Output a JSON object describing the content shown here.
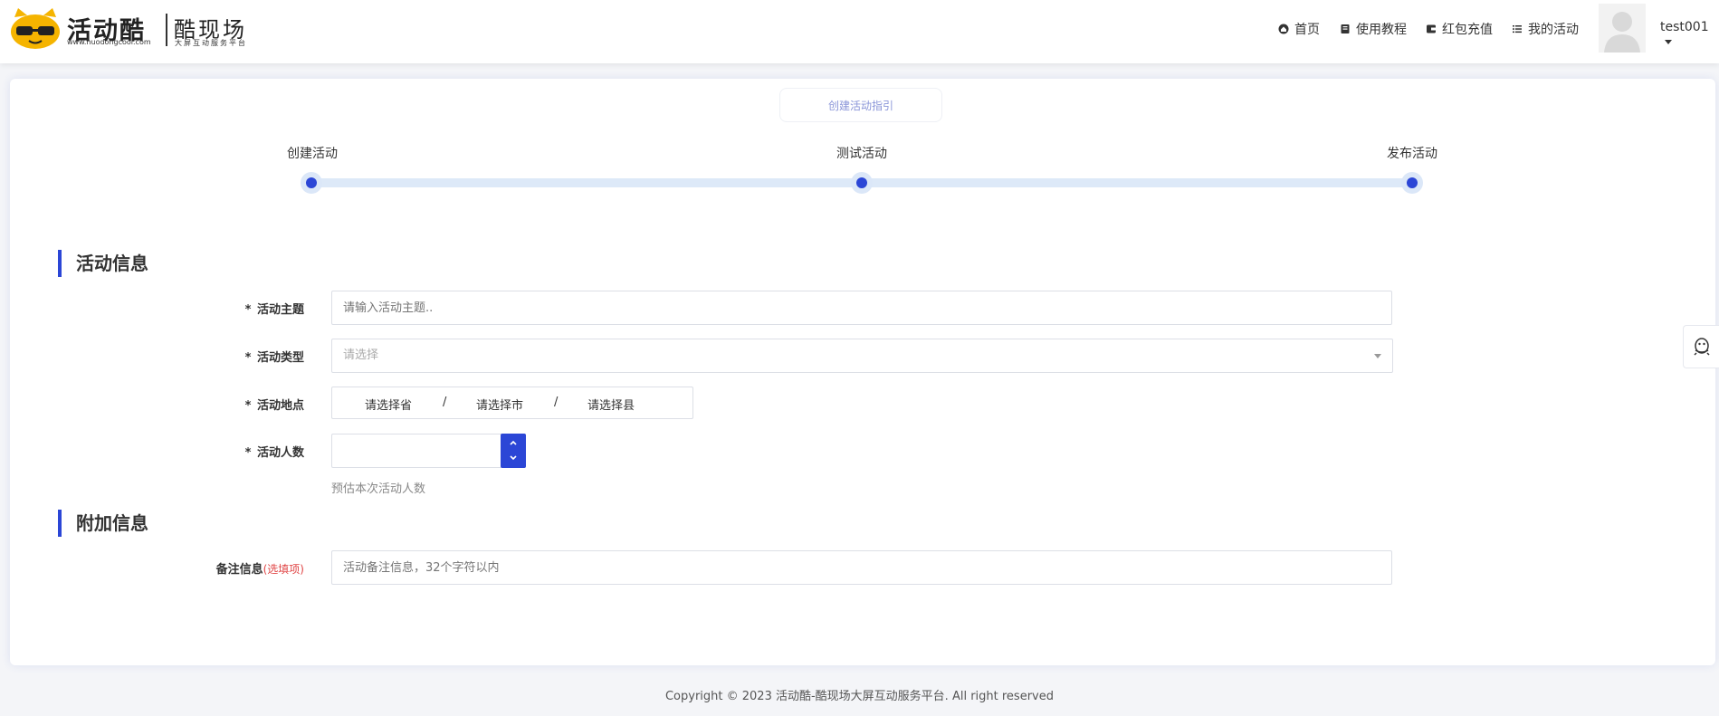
{
  "header": {
    "logo": {
      "main_text": "活动酷",
      "url_text": "www.huodongcool.com",
      "sub_text": "酷现场",
      "sub_caption": "大屏互动服务平台"
    },
    "nav": [
      {
        "label": "首页",
        "icon": "home-icon"
      },
      {
        "label": "使用教程",
        "icon": "book-icon"
      },
      {
        "label": "红包充值",
        "icon": "wallet-icon"
      },
      {
        "label": "我的活动",
        "icon": "list-icon"
      }
    ],
    "username": "test001"
  },
  "guide_button": "创建活动指引",
  "steps": [
    {
      "label": "创建活动"
    },
    {
      "label": "测试活动"
    },
    {
      "label": "发布活动"
    }
  ],
  "sections": {
    "activity_info": "活动信息",
    "extra_info": "附加信息"
  },
  "form": {
    "theme": {
      "required": "*",
      "label": "活动主题",
      "placeholder": "请输入活动主题.."
    },
    "type": {
      "required": "*",
      "label": "活动类型",
      "placeholder": "请选择"
    },
    "location": {
      "required": "*",
      "label": "活动地点",
      "province": "请选择省",
      "city": "请选择市",
      "county": "请选择县",
      "separator": "/"
    },
    "people": {
      "required": "*",
      "label": "活动人数",
      "value": "",
      "hint": "预估本次活动人数"
    },
    "remark": {
      "label": "备注信息",
      "optional": "(选填项)",
      "placeholder": "活动备注信息，32个字符以内"
    }
  },
  "footer": "Copyright © 2023 活动酷-酷现场大屏互动服务平台. All right reserved",
  "colors": {
    "accent": "#2b46d6",
    "step_track": "#dde9f8",
    "optional_red": "#e04545",
    "logo_yellow": "#f5b400"
  }
}
